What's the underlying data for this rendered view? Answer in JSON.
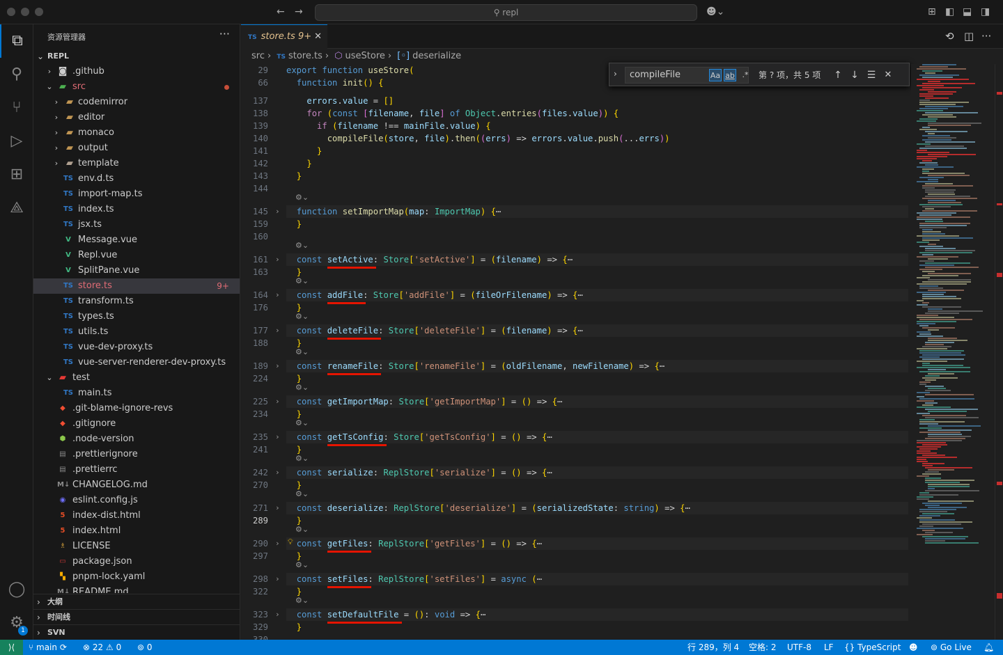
{
  "window": {
    "search_text": "repl"
  },
  "sidebar": {
    "title": "资源管理器",
    "more": "···",
    "root": "REPL",
    "tree": [
      {
        "label": ".github",
        "depth": 1,
        "chev": "›",
        "icon": "git-folder-icon",
        "glyph": "◙",
        "color": "#cccccc"
      },
      {
        "label": "src",
        "depth": 1,
        "chev": "⌄",
        "icon": "src-folder-icon",
        "glyph": "▰",
        "color": "#4caf50",
        "label_color": "#e06c75",
        "dot": true
      },
      {
        "label": "codemirror",
        "depth": 2,
        "chev": "›",
        "icon": "folder-icon",
        "glyph": "▰",
        "color": "#c09553"
      },
      {
        "label": "editor",
        "depth": 2,
        "chev": "›",
        "icon": "folder-icon",
        "glyph": "▰",
        "color": "#c09553"
      },
      {
        "label": "monaco",
        "depth": 2,
        "chev": "›",
        "icon": "folder-icon",
        "glyph": "▰",
        "color": "#c09553"
      },
      {
        "label": "output",
        "depth": 2,
        "chev": "›",
        "icon": "folder-icon",
        "glyph": "▰",
        "color": "#c09553"
      },
      {
        "label": "template",
        "depth": 2,
        "chev": "›",
        "icon": "template-folder-icon",
        "glyph": "▰",
        "color": "#b0a090"
      },
      {
        "label": "env.d.ts",
        "depth": 2,
        "icon": "typescript-icon",
        "glyph": "TS",
        "color": "#3178c6"
      },
      {
        "label": "import-map.ts",
        "depth": 2,
        "icon": "typescript-icon",
        "glyph": "TS",
        "color": "#3178c6"
      },
      {
        "label": "index.ts",
        "depth": 2,
        "icon": "typescript-icon",
        "glyph": "TS",
        "color": "#3178c6"
      },
      {
        "label": "jsx.ts",
        "depth": 2,
        "icon": "typescript-icon",
        "glyph": "TS",
        "color": "#3178c6"
      },
      {
        "label": "Message.vue",
        "depth": 2,
        "icon": "vue-icon",
        "glyph": "V",
        "color": "#41b883"
      },
      {
        "label": "Repl.vue",
        "depth": 2,
        "icon": "vue-icon",
        "glyph": "V",
        "color": "#41b883"
      },
      {
        "label": "SplitPane.vue",
        "depth": 2,
        "icon": "vue-icon",
        "glyph": "V",
        "color": "#41b883"
      },
      {
        "label": "store.ts",
        "depth": 2,
        "icon": "typescript-icon",
        "glyph": "TS",
        "color": "#3178c6",
        "label_color": "#e06c75",
        "selected": true,
        "badge": "9+"
      },
      {
        "label": "transform.ts",
        "depth": 2,
        "icon": "typescript-icon",
        "glyph": "TS",
        "color": "#3178c6"
      },
      {
        "label": "types.ts",
        "depth": 2,
        "icon": "typescript-icon",
        "glyph": "TS",
        "color": "#3178c6"
      },
      {
        "label": "utils.ts",
        "depth": 2,
        "icon": "typescript-icon",
        "glyph": "TS",
        "color": "#3178c6"
      },
      {
        "label": "vue-dev-proxy.ts",
        "depth": 2,
        "icon": "typescript-icon",
        "glyph": "TS",
        "color": "#3178c6"
      },
      {
        "label": "vue-server-renderer-dev-proxy.ts",
        "depth": 2,
        "icon": "typescript-icon",
        "glyph": "TS",
        "color": "#3178c6"
      },
      {
        "label": "test",
        "depth": 1,
        "chev": "⌄",
        "icon": "test-folder-icon",
        "glyph": "▰",
        "color": "#e53935"
      },
      {
        "label": "main.ts",
        "depth": 2,
        "icon": "typescript-icon",
        "glyph": "TS",
        "color": "#3178c6"
      },
      {
        "label": ".git-blame-ignore-revs",
        "depth": 1,
        "icon": "git-icon",
        "glyph": "◆",
        "color": "#f14e32"
      },
      {
        "label": ".gitignore",
        "depth": 1,
        "icon": "git-icon",
        "glyph": "◆",
        "color": "#f14e32"
      },
      {
        "label": ".node-version",
        "depth": 1,
        "icon": "node-icon",
        "glyph": "⬢",
        "color": "#8cc84b"
      },
      {
        "label": ".prettierignore",
        "depth": 1,
        "icon": "prettier-icon",
        "glyph": "▤",
        "color": "#8a8a8a"
      },
      {
        "label": ".prettierrc",
        "depth": 1,
        "icon": "prettier-icon",
        "glyph": "▤",
        "color": "#8a8a8a"
      },
      {
        "label": "CHANGELOG.md",
        "depth": 1,
        "icon": "markdown-icon",
        "glyph": "M↓",
        "color": "#8a8a8a"
      },
      {
        "label": "eslint.config.js",
        "depth": 1,
        "icon": "eslint-icon",
        "glyph": "◉",
        "color": "#6d6df7"
      },
      {
        "label": "index-dist.html",
        "depth": 1,
        "icon": "html-icon",
        "glyph": "5",
        "color": "#e44d26"
      },
      {
        "label": "index.html",
        "depth": 1,
        "icon": "html-icon",
        "glyph": "5",
        "color": "#e44d26"
      },
      {
        "label": "LICENSE",
        "depth": 1,
        "icon": "license-icon",
        "glyph": "♗",
        "color": "#d4a03a"
      },
      {
        "label": "package.json",
        "depth": 1,
        "icon": "npm-icon",
        "glyph": "▭",
        "color": "#cb3837"
      },
      {
        "label": "pnpm-lock.yaml",
        "depth": 1,
        "icon": "pnpm-icon",
        "glyph": "▚",
        "color": "#f9ad00"
      },
      {
        "label": "README.md",
        "depth": 1,
        "icon": "markdown-icon",
        "glyph": "M↓",
        "color": "#8a8a8a"
      }
    ],
    "sections": {
      "outline": "大纲",
      "timeline": "时间线",
      "svn": "SVN"
    }
  },
  "activity": {
    "settings_badge": "1"
  },
  "editor": {
    "tab": {
      "label": "store.ts",
      "badge": "9+"
    },
    "breadcrumb": [
      "src",
      "store.ts",
      "useStore",
      "deserialize"
    ],
    "find": {
      "query": "compileFile",
      "case": "Aa",
      "word": "ab",
      "regex": ".*",
      "count": "第 ? 项，共 5 项"
    }
  },
  "statusbar": {
    "branch": "main",
    "errors": "22",
    "warnings": "0",
    "ports": "0",
    "position": "行 289，列 4",
    "indent": "空格: 2",
    "encoding": "UTF-8",
    "eol": "LF",
    "language": "TypeScript",
    "live": "Go Live"
  },
  "colors": {
    "accent": "#0078d4",
    "remote": "#16825d",
    "error_underline": "#e51400"
  }
}
